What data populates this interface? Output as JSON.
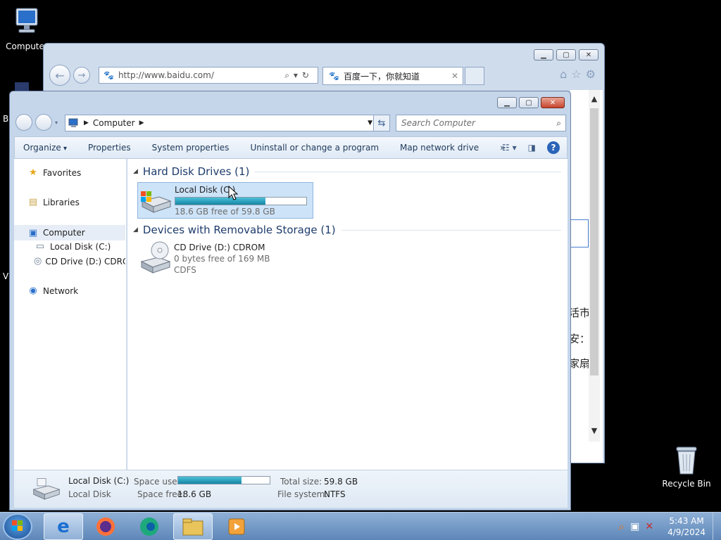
{
  "desktop": {
    "computer_icon_label": "Computer",
    "recycle_bin_label": "Recycle Bin",
    "edge_fragment_b": "B",
    "edge_fragment_v": "V"
  },
  "ie": {
    "url": "http://www.baidu.com/",
    "tab_title": "百度一下，你就知道",
    "tab_close": "✕",
    "page_text": [
      "活市",
      "安：",
      "家扇"
    ]
  },
  "explorer": {
    "breadcrumb": [
      "Computer"
    ],
    "search_placeholder": "Search Computer",
    "toolbar": {
      "organize": "Organize",
      "properties": "Properties",
      "system_properties": "System properties",
      "uninstall": "Uninstall or change a program",
      "map_network_drive": "Map network drive",
      "more": "»"
    },
    "nav": {
      "favorites": "Favorites",
      "libraries": "Libraries",
      "computer": "Computer",
      "local_disk": "Local Disk (C:)",
      "cd_drive": "CD Drive (D:) CDROM",
      "network": "Network"
    },
    "groups": {
      "hard_disk": "Hard Disk Drives (1)",
      "removable": "Devices with Removable Storage (1)"
    },
    "drives": {
      "c": {
        "name": "Local Disk (C:)",
        "free_text": "18.6 GB free of 59.8 GB",
        "used_fraction": 0.69
      },
      "d": {
        "name": "CD Drive (D:) CDROM",
        "free_text": "0 bytes free of 169 MB",
        "fs": "CDFS"
      }
    },
    "details": {
      "name": "Local Disk (C:)",
      "type": "Local Disk",
      "space_used_label": "Space used:",
      "space_free_label": "Space free:",
      "space_free_value": "18.6 GB",
      "total_size_label": "Total size:",
      "total_size_value": "59.8 GB",
      "file_system_label": "File system:",
      "file_system_value": "NTFS",
      "used_fraction": 0.69
    }
  },
  "taskbar": {
    "time": "5:43 AM",
    "date": "4/9/2024"
  },
  "colors": {
    "bar_fill": "#1586a5",
    "taskbar": "#5d86b8",
    "close_button": "#c7442c"
  }
}
